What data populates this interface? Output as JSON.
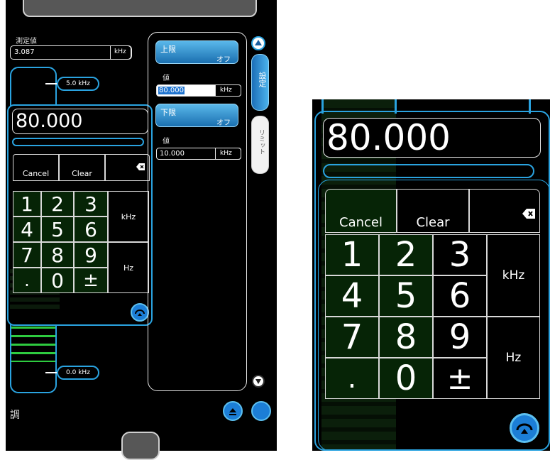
{
  "colors": {
    "accent": "#2aa3e0",
    "panel": "#000000",
    "key_green": "#062406",
    "bar_green": "#2ecc40"
  },
  "left": {
    "measured_label": "測定値",
    "measured_value": "3.087",
    "measured_unit": "kHz",
    "marker_top": "5.0 kHz",
    "marker_bottom": "0.0 kHz",
    "entry_value": "80.000",
    "bottom_label": "調",
    "keypad": {
      "cancel": "Cancel",
      "clear": "Clear",
      "digits": [
        "1",
        "2",
        "3",
        "4",
        "5",
        "6",
        "7",
        "8",
        "9",
        ".",
        "0",
        "±"
      ],
      "unit_khz": "kHz",
      "unit_hz": "Hz"
    },
    "limits": {
      "upper_label": "上限",
      "upper_state": "オフ",
      "value_label": "値",
      "upper_value": "80.000",
      "upper_unit": "kHz",
      "lower_label": "下限",
      "lower_state": "オフ",
      "value_label2": "値",
      "lower_value": "10.000",
      "lower_unit": "kHz"
    },
    "tabs": {
      "settings": "設定",
      "limit": "リミット"
    }
  },
  "right": {
    "entry_value": "80.000",
    "keypad": {
      "cancel": "Cancel",
      "clear": "Clear",
      "digits": [
        "1",
        "2",
        "3",
        "4",
        "5",
        "6",
        "7",
        "8",
        "9",
        ".",
        "0",
        "±"
      ],
      "unit_khz": "kHz",
      "unit_hz": "Hz"
    }
  }
}
